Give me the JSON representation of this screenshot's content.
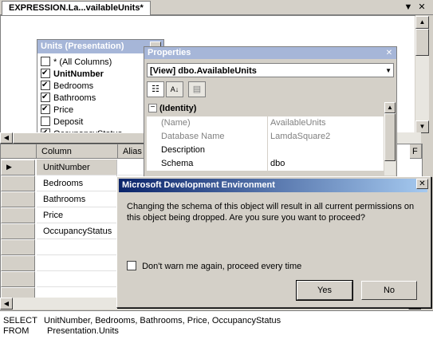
{
  "tab": {
    "title": "EXPRESSION.La...vailableUnits*"
  },
  "window_controls": {
    "dropdown_glyph": "▼",
    "close_glyph": "✕"
  },
  "units_table": {
    "title": "Units (Presentation)",
    "minimize_glyph": "_",
    "columns": [
      {
        "label": "* (All Columns)",
        "checked": false,
        "bold": false
      },
      {
        "label": "UnitNumber",
        "checked": true,
        "bold": true
      },
      {
        "label": "Bedrooms",
        "checked": true,
        "bold": false
      },
      {
        "label": "Bathrooms",
        "checked": true,
        "bold": false
      },
      {
        "label": "Price",
        "checked": true,
        "bold": false
      },
      {
        "label": "Deposit",
        "checked": false,
        "bold": false
      },
      {
        "label": "OccupancyStatus",
        "checked": true,
        "bold": false
      }
    ]
  },
  "grid": {
    "headers": {
      "column": "Column",
      "alias": "Alias",
      "right": "F"
    },
    "rows": [
      "UnitNumber",
      "Bedrooms",
      "Bathrooms",
      "Price",
      "OccupancyStatus",
      "",
      "",
      "",
      ""
    ],
    "selected_indicator": "▶"
  },
  "sql": {
    "lines": [
      {
        "keyword": "SELECT",
        "text": "UnitNumber, Bedrooms, Bathrooms, Price, OccupancyStatus"
      },
      {
        "keyword": "FROM",
        "text": "Presentation.Units"
      }
    ]
  },
  "properties": {
    "title": "Properties",
    "close_glyph": "✕",
    "object": "[View] dbo.AvailableUnits",
    "dropdown_glyph": "▼",
    "toolbar": {
      "categorized_glyph": "☷",
      "alphabetical_glyph": "A↓",
      "pages_glyph": "▤"
    },
    "category": {
      "toggle": "−",
      "label": "(Identity)"
    },
    "rows": [
      {
        "name": "(Name)",
        "value": "AvailableUnits",
        "gray": true
      },
      {
        "name": "Database Name",
        "value": "LamdaSquare2",
        "gray": true
      },
      {
        "name": "Description",
        "value": "",
        "gray": false
      },
      {
        "name": "Schema",
        "value": "dbo",
        "gray": false
      }
    ]
  },
  "dialog": {
    "title": "Microsoft Development Environment",
    "close_glyph": "✕",
    "message": "Changing the schema of this object will result in all current permissions on this object being dropped. Are you sure you want to proceed?",
    "checkbox_label": "Don't warn me again, proceed every time",
    "checkbox_checked": false,
    "yes_label": "Yes",
    "no_label": "No"
  },
  "scroll": {
    "up": "▲",
    "down": "▼",
    "left": "◀",
    "right": "▶"
  }
}
